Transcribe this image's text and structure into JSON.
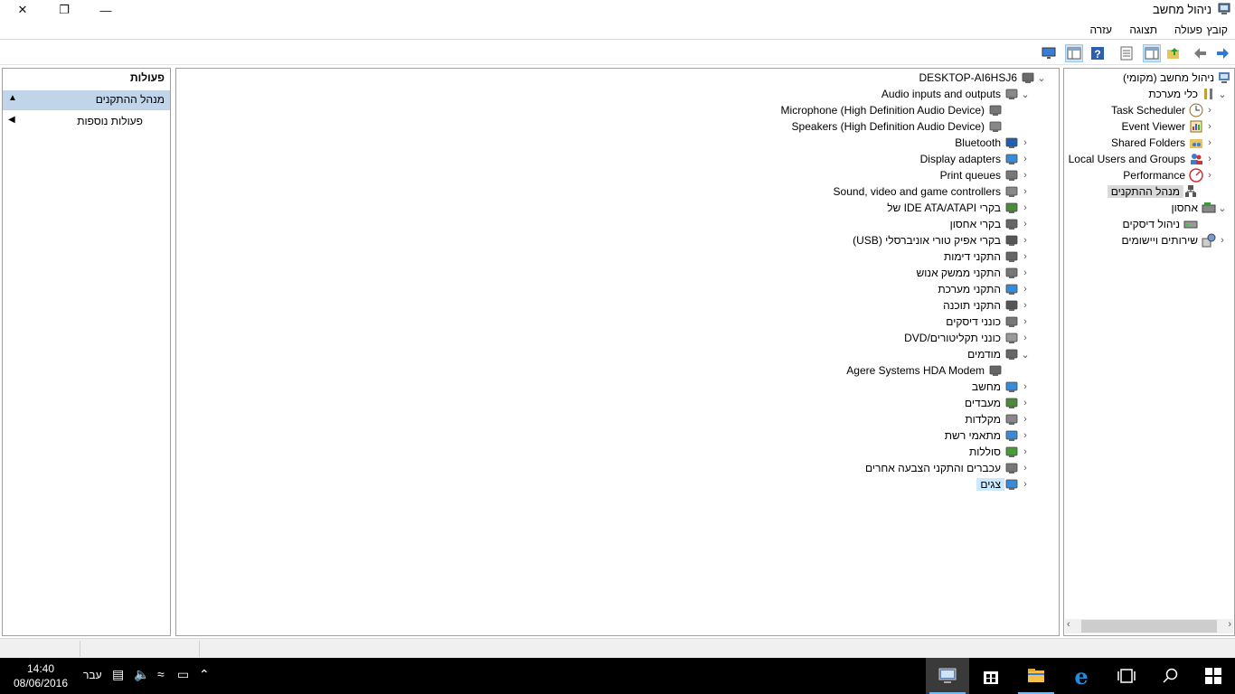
{
  "window": {
    "title": "ניהול מחשב",
    "close_glyph": "✕",
    "maximize_glyph": "❐",
    "minimize_glyph": "—"
  },
  "menu": [
    "קובץ",
    "פעולה",
    "תצוגה",
    "עזרה"
  ],
  "toolbar_icons": [
    "forward-icon",
    "back-icon",
    "up-folder-icon",
    "show-tree-icon",
    "properties-icon",
    "help-icon",
    "show-action-pane-icon",
    "monitor-icon"
  ],
  "tree": {
    "root": "ניהול מחשב (מקומי)",
    "system_tools": "כלי מערכת",
    "task_scheduler": "Task Scheduler",
    "event_viewer": "Event Viewer",
    "shared_folders": "Shared Folders",
    "local_users": "Local Users and Groups",
    "performance": "Performance",
    "device_manager": "מנהל ההתקנים",
    "storage": "אחסון",
    "disk_management": "ניהול דיסקים",
    "services_apps": "שירותים ויישומים"
  },
  "devices": {
    "computer": "DESKTOP-AI6HSJ6",
    "audio": "Audio inputs and outputs",
    "microphone": "Microphone (High Definition Audio Device)",
    "speakers": "Speakers (High Definition Audio Device)",
    "bluetooth": "Bluetooth",
    "display": "Display adapters",
    "print": "Print queues",
    "sound": "Sound, video and game controllers",
    "ide": "בקרי IDE ATA/ATAPI של",
    "storage_ctrl": "בקרי אחסון",
    "usb": "בקרי אפיק טורי אוניברסלי (USB)",
    "imaging": "התקני דימות",
    "hid": "התקני ממשק אנוש",
    "system_dev": "התקני מערכת",
    "software_dev": "התקני תוכנה",
    "disk_drives": "כונני דיסקים",
    "dvd": "כונני תקליטורים/DVD",
    "modems": "מודמים",
    "agere": "Agere Systems HDA Modem",
    "computer_cat": "מחשב",
    "processors": "מעבדים",
    "keyboards": "מקלדות",
    "network": "מתאמי רשת",
    "batteries": "סוללות",
    "mice": "עכברים והתקני הצבעה אחרים",
    "monitors": "צגים"
  },
  "actions": {
    "header": "פעולות",
    "section": "מנהל ההתקנים",
    "more": "פעולות נוספות"
  },
  "taskbar": {
    "time": "14:40",
    "date": "08/06/2016",
    "language": "עבר"
  },
  "colors": {
    "selection": "#cce8ff",
    "action_section": "#c0d4ea",
    "taskbar": "#000000",
    "accent": "#0078d7"
  }
}
